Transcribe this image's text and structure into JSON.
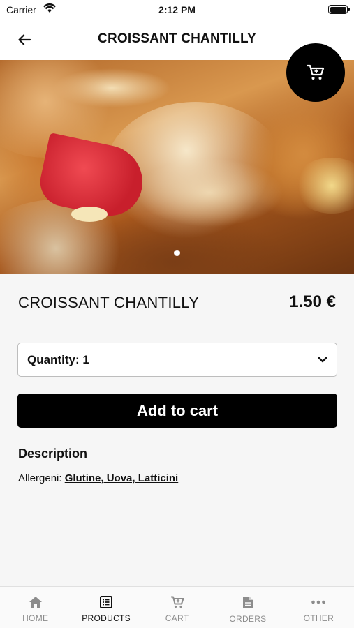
{
  "status_bar": {
    "carrier": "Carrier",
    "time": "2:12 PM"
  },
  "nav": {
    "title": "CROISSANT CHANTILLY",
    "back_icon": "arrow-left-icon"
  },
  "product": {
    "name": "CROISSANT CHANTILLY",
    "price": "1.50 €",
    "quantity_label": "Quantity: 1",
    "add_to_cart": "Add to cart",
    "description_heading": "Description",
    "allergens_prefix": "Allergeni: ",
    "allergens_list": "Glutine, Uova, Latticini",
    "image_pages": 1,
    "current_image_page": 1
  },
  "tabs": [
    {
      "label": "HOME",
      "icon": "home-icon",
      "active": false
    },
    {
      "label": "PRODUCTS",
      "icon": "list-icon",
      "active": true
    },
    {
      "label": "CART",
      "icon": "cart-icon",
      "active": false
    },
    {
      "label": "ORDERS",
      "icon": "document-icon",
      "active": false
    },
    {
      "label": "OTHER",
      "icon": "more-icon",
      "active": false
    }
  ],
  "colors": {
    "accent": "#000000",
    "background": "#f6f6f6",
    "tab_inactive": "#8c8c8c"
  }
}
